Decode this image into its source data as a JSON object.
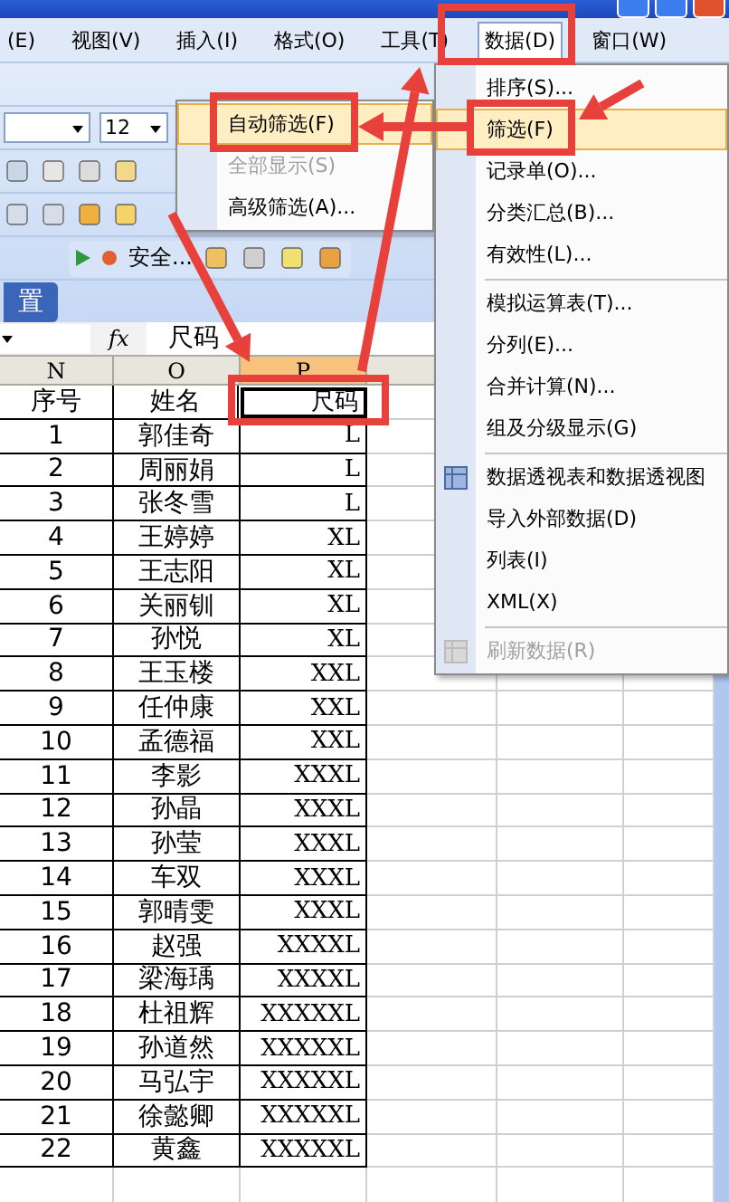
{
  "menu_bar": {
    "items": [
      {
        "label": "(E)",
        "selected": false
      },
      {
        "label": "视图(V)",
        "selected": false
      },
      {
        "label": "插入(I)",
        "selected": false
      },
      {
        "label": "格式(O)",
        "selected": false
      },
      {
        "label": "工具(T)",
        "selected": false
      },
      {
        "label": "数据(D)",
        "selected": true
      },
      {
        "label": "窗口(W)",
        "selected": false
      }
    ]
  },
  "toolbar": {
    "font_size": "12",
    "security_label": "安全...",
    "tab_label": "置"
  },
  "formula_bar": {
    "function_label": "fx",
    "content": "尺码"
  },
  "sheet": {
    "columns": [
      {
        "label": "N",
        "selected": false
      },
      {
        "label": "O",
        "selected": false
      },
      {
        "label": "P",
        "selected": true
      }
    ],
    "header_cells": [
      {
        "text": "序号",
        "selected": false
      },
      {
        "text": "姓名",
        "selected": false
      },
      {
        "text": "尺码",
        "selected": true
      }
    ],
    "rows": [
      [
        "1",
        "郭佳奇",
        "L"
      ],
      [
        "2",
        "周丽娟",
        "L"
      ],
      [
        "3",
        "张冬雪",
        "L"
      ],
      [
        "4",
        "王婷婷",
        "XL"
      ],
      [
        "5",
        "王志阳",
        "XL"
      ],
      [
        "6",
        "关丽钏",
        "XL"
      ],
      [
        "7",
        "孙悦",
        "XL"
      ],
      [
        "8",
        "王玉楼",
        "XXL"
      ],
      [
        "9",
        "任仲康",
        "XXL"
      ],
      [
        "10",
        "孟德福",
        "XXL"
      ],
      [
        "11",
        "李影",
        "XXXL"
      ],
      [
        "12",
        "孙晶",
        "XXXL"
      ],
      [
        "13",
        "孙莹",
        "XXXL"
      ],
      [
        "14",
        "车双",
        "XXXL"
      ],
      [
        "15",
        "郭晴雯",
        "XXXL"
      ],
      [
        "16",
        "赵强",
        "XXXXL"
      ],
      [
        "17",
        "梁海瑀",
        "XXXXL"
      ],
      [
        "18",
        "杜祖辉",
        "XXXXXL"
      ],
      [
        "19",
        "孙道然",
        "XXXXXL"
      ],
      [
        "20",
        "马弘宇",
        "XXXXXL"
      ],
      [
        "21",
        "徐懿卿",
        "XXXXXL"
      ],
      [
        "22",
        "黄鑫",
        "XXXXXL"
      ]
    ]
  },
  "filter_submenu": {
    "items": [
      {
        "kind": "command",
        "label": "自动筛选(F)",
        "selected": true,
        "disabled": false
      },
      {
        "kind": "command",
        "label": "全部显示(S)",
        "selected": false,
        "disabled": true
      },
      {
        "kind": "command",
        "label": "高级筛选(A)...",
        "selected": false,
        "disabled": false
      }
    ]
  },
  "data_menu": {
    "items": [
      {
        "kind": "command",
        "label": "排序(S)...",
        "selected": false,
        "disabled": false
      },
      {
        "kind": "command",
        "label": "筛选(F)",
        "selected": true,
        "disabled": false
      },
      {
        "kind": "command",
        "label": "记录单(O)...",
        "selected": false,
        "disabled": false
      },
      {
        "kind": "command",
        "label": "分类汇总(B)...",
        "selected": false,
        "disabled": false
      },
      {
        "kind": "command",
        "label": "有效性(L)...",
        "selected": false,
        "disabled": false
      },
      {
        "kind": "separator"
      },
      {
        "kind": "command",
        "label": "模拟运算表(T)...",
        "selected": false,
        "disabled": false
      },
      {
        "kind": "command",
        "label": "分列(E)...",
        "selected": false,
        "disabled": false
      },
      {
        "kind": "command",
        "label": "合并计算(N)...",
        "selected": false,
        "disabled": false
      },
      {
        "kind": "command",
        "label": "组及分级显示(G)",
        "selected": false,
        "disabled": false
      },
      {
        "kind": "separator"
      },
      {
        "kind": "icon_command",
        "label": "数据透视表和数据透视图",
        "selected": false,
        "disabled": false
      },
      {
        "kind": "command",
        "label": "导入外部数据(D)",
        "selected": false,
        "disabled": false
      },
      {
        "kind": "command",
        "label": "列表(I)",
        "selected": false,
        "disabled": false
      },
      {
        "kind": "command",
        "label": "XML(X)",
        "selected": false,
        "disabled": false
      },
      {
        "kind": "separator"
      },
      {
        "kind": "icon_command",
        "label": "刷新数据(R)",
        "selected": false,
        "disabled": true
      }
    ]
  }
}
